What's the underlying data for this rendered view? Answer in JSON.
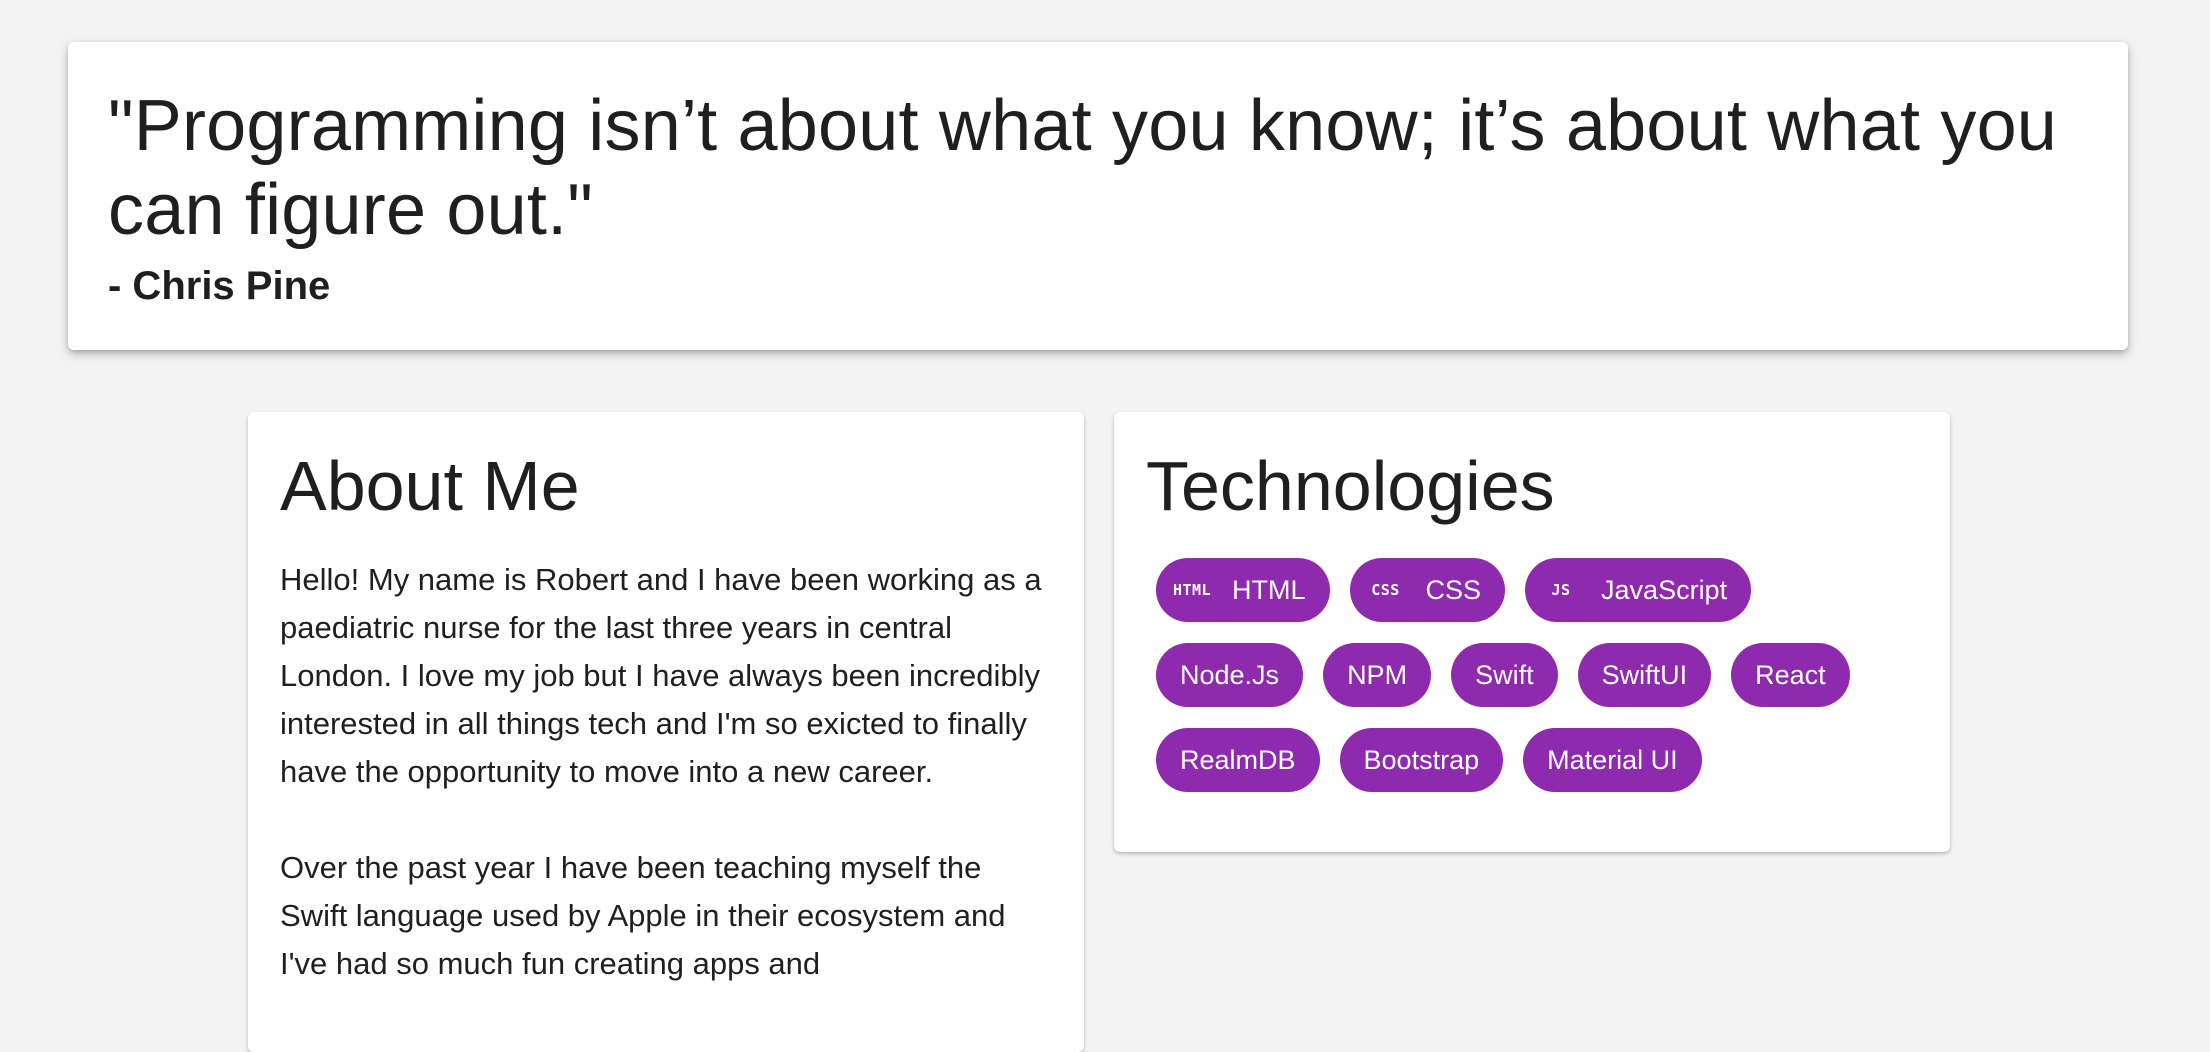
{
  "quote": {
    "text": "\"Programming isn’t about what you know; it’s about what you can figure out.\"",
    "author": "- Chris Pine"
  },
  "about": {
    "title": "About Me",
    "paragraphs": [
      "Hello! My name is Robert and I have been working as a paediatric nurse for the last three years in central London. I love my job but I have always been incredibly interested in all things tech and I'm so exicted to finally have the opportunity to move into a new career.",
      "Over the past year I have been teaching myself the Swift language used by Apple in their ecosystem and I've had so much fun creating apps and"
    ]
  },
  "technologies": {
    "title": "Technologies",
    "chips": [
      {
        "label": "HTML",
        "icon": "HTML",
        "icon_name": "html-icon"
      },
      {
        "label": "CSS",
        "icon": "CSS",
        "icon_name": "css-icon"
      },
      {
        "label": "JavaScript",
        "icon": "JS",
        "icon_name": "javascript-icon"
      },
      {
        "label": "Node.Js"
      },
      {
        "label": "NPM"
      },
      {
        "label": "Swift"
      },
      {
        "label": "SwiftUI"
      },
      {
        "label": "React"
      },
      {
        "label": "RealmDB"
      },
      {
        "label": "Bootstrap"
      },
      {
        "label": "Material UI"
      }
    ],
    "chip_color": "#8e2aae"
  },
  "colors": {
    "background": "#f3f3f3",
    "card": "#ffffff",
    "text": "#1f1f1f",
    "accent": "#8e2aae"
  }
}
